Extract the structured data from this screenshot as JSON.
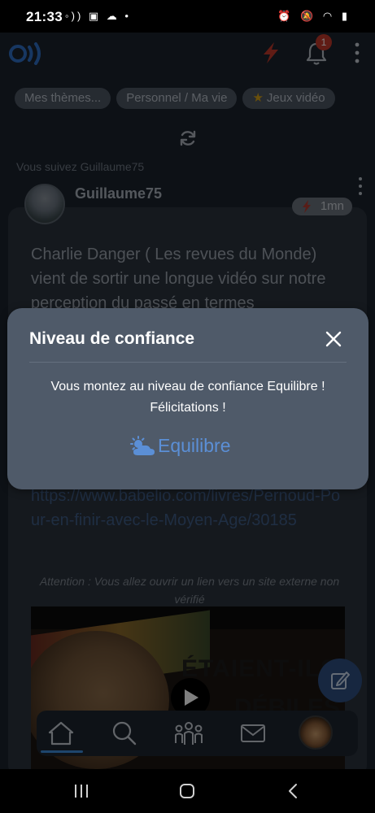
{
  "status_bar": {
    "time": "21:33",
    "left_icons": "◦)) ▣ ☁ •",
    "right_icons": "⏰ 🔕 ◠ ▮"
  },
  "app_bar": {
    "notification_count": "1",
    "brand_color": "#2f6fc4",
    "bolt_color": "#c0392b"
  },
  "feed": {
    "chips": [
      {
        "label": "Mes thèmes..."
      },
      {
        "label": "Personnel / Ma vie"
      },
      {
        "label": "Jeux vidéo"
      }
    ],
    "following_label": "Vous suivez Guillaume75",
    "post": {
      "author": "Guillaume75",
      "time_ago": "1mn",
      "text": "Charlie Danger ( Les revues du Monde) vient de sortir une longue vidéo sur notre perception du passé en termes",
      "link": "https://www.babelio.com/livres/Pernoud-Pour-en-finir-avec-le-Moyen-Age/30185",
      "warning": "Attention : Vous allez ouvrir un lien vers un site externe non vérifié",
      "video_title_line1": "ÉTAIENT-ILS",
      "video_title_line2": "DÉBILES ?"
    }
  },
  "dialog": {
    "title": "Niveau de confiance",
    "message": "Vous montez au niveau de confiance Equilibre ! Félicitations !",
    "level_label": "Equilibre",
    "level_icon": "sun-cloud-icon",
    "accent_color": "#5b8fd6"
  },
  "bottom_nav": {
    "items": [
      "home-icon",
      "search-icon",
      "community-icon",
      "mail-icon",
      "profile-avatar"
    ]
  }
}
